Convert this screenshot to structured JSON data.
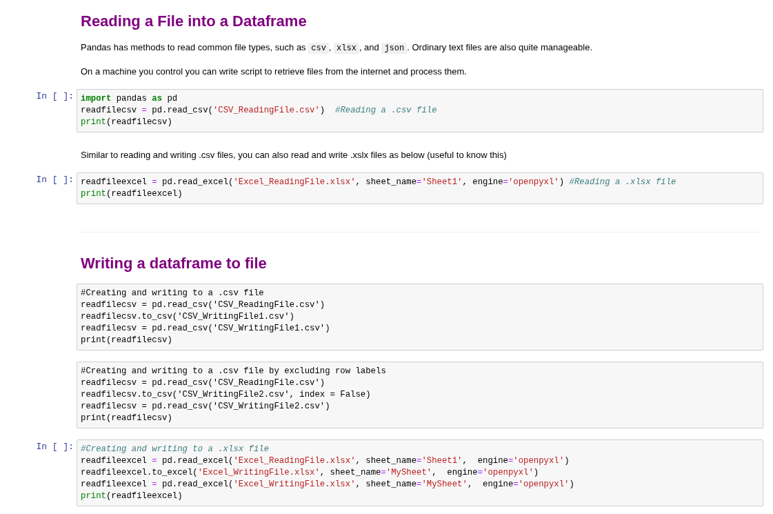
{
  "cells": [
    {
      "kind": "heading",
      "text": "Reading a File into a Dataframe"
    },
    {
      "kind": "paragraph",
      "parts": [
        {
          "kind": "text",
          "text": "Pandas has methods to read common file types, such as "
        },
        {
          "kind": "code",
          "text": "csv"
        },
        {
          "kind": "text",
          "text": ", "
        },
        {
          "kind": "code",
          "text": "xlsx"
        },
        {
          "kind": "text",
          "text": ", and "
        },
        {
          "kind": "code",
          "text": "json"
        },
        {
          "kind": "text",
          "text": ". Ordinary text files are also quite manageable."
        }
      ]
    },
    {
      "kind": "paragraph",
      "parts": [
        {
          "kind": "text",
          "text": "On a machine you control you can write script to retrieve files from the internet and process them."
        }
      ]
    },
    {
      "kind": "code",
      "prompt": "In [ ]:",
      "lines": [
        [
          {
            "kind": "keyword",
            "text": "import"
          },
          {
            "kind": "plain",
            "text": " pandas "
          },
          {
            "kind": "keyword",
            "text": "as"
          },
          {
            "kind": "plain",
            "text": " pd"
          }
        ],
        [
          {
            "kind": "plain",
            "text": "readfilecsv "
          },
          {
            "kind": "operator",
            "text": "="
          },
          {
            "kind": "plain",
            "text": " pd.read_csv("
          },
          {
            "kind": "string",
            "text": "'CSV_ReadingFile.csv'"
          },
          {
            "kind": "plain",
            "text": ")  "
          },
          {
            "kind": "comment",
            "text": "#Reading a .csv file"
          }
        ],
        [
          {
            "kind": "builtin",
            "text": "print"
          },
          {
            "kind": "plain",
            "text": "(readfilecsv)"
          }
        ]
      ]
    },
    {
      "kind": "paragraph",
      "parts": [
        {
          "kind": "text",
          "text": "Similar to reading and writing .csv files, you can also read and write .xslx files as below (useful to know this)"
        }
      ]
    },
    {
      "kind": "code",
      "prompt": "In [ ]:",
      "lines": [
        [
          {
            "kind": "plain",
            "text": "readfileexcel "
          },
          {
            "kind": "operator",
            "text": "="
          },
          {
            "kind": "plain",
            "text": " pd.read_excel("
          },
          {
            "kind": "string",
            "text": "'Excel_ReadingFile.xlsx'"
          },
          {
            "kind": "plain",
            "text": ", sheet_name"
          },
          {
            "kind": "operator",
            "text": "="
          },
          {
            "kind": "string",
            "text": "'Sheet1'"
          },
          {
            "kind": "plain",
            "text": ", engine"
          },
          {
            "kind": "operator",
            "text": "="
          },
          {
            "kind": "string",
            "text": "'openpyxl'"
          },
          {
            "kind": "plain",
            "text": ") "
          },
          {
            "kind": "comment",
            "text": "#Reading a .xlsx file"
          }
        ],
        [
          {
            "kind": "builtin",
            "text": "print"
          },
          {
            "kind": "plain",
            "text": "(readfileexcel)"
          }
        ]
      ]
    },
    {
      "kind": "rule"
    },
    {
      "kind": "heading",
      "text": "Writing a dataframe to file"
    },
    {
      "kind": "code",
      "lines": [
        [
          {
            "kind": "plain",
            "text": "#Creating and writing to a .csv file"
          }
        ],
        [
          {
            "kind": "plain",
            "text": "readfilecsv = pd.read_csv('CSV_ReadingFile.csv')"
          }
        ],
        [
          {
            "kind": "plain",
            "text": "readfilecsv.to_csv('CSV_WritingFile1.csv')"
          }
        ],
        [
          {
            "kind": "plain",
            "text": "readfilecsv = pd.read_csv('CSV_WritingFile1.csv')"
          }
        ],
        [
          {
            "kind": "plain",
            "text": "print(readfilecsv)"
          }
        ]
      ]
    },
    {
      "kind": "code",
      "lines": [
        [
          {
            "kind": "plain",
            "text": "#Creating and writing to a .csv file by excluding row labels"
          }
        ],
        [
          {
            "kind": "plain",
            "text": "readfilecsv = pd.read_csv('CSV_ReadingFile.csv')"
          }
        ],
        [
          {
            "kind": "plain",
            "text": "readfilecsv.to_csv('CSV_WritingFile2.csv', index = False)"
          }
        ],
        [
          {
            "kind": "plain",
            "text": "readfilecsv = pd.read_csv('CSV_WritingFile2.csv')"
          }
        ],
        [
          {
            "kind": "plain",
            "text": "print(readfilecsv)"
          }
        ]
      ]
    },
    {
      "kind": "code",
      "prompt": "In [ ]:",
      "lines": [
        [
          {
            "kind": "comment",
            "text": "#Creating and writing to a .xlsx file"
          }
        ],
        [
          {
            "kind": "plain",
            "text": "readfileexcel "
          },
          {
            "kind": "operator",
            "text": "="
          },
          {
            "kind": "plain",
            "text": " pd.read_excel("
          },
          {
            "kind": "string",
            "text": "'Excel_ReadingFile.xlsx'"
          },
          {
            "kind": "plain",
            "text": ", sheet_name"
          },
          {
            "kind": "operator",
            "text": "="
          },
          {
            "kind": "string",
            "text": "'Sheet1'"
          },
          {
            "kind": "plain",
            "text": ",  engine"
          },
          {
            "kind": "operator",
            "text": "="
          },
          {
            "kind": "string",
            "text": "'openpyxl'"
          },
          {
            "kind": "plain",
            "text": ")"
          }
        ],
        [
          {
            "kind": "plain",
            "text": "readfileexcel.to_excel("
          },
          {
            "kind": "string",
            "text": "'Excel_WritingFile.xlsx'"
          },
          {
            "kind": "plain",
            "text": ", sheet_name"
          },
          {
            "kind": "operator",
            "text": "="
          },
          {
            "kind": "string",
            "text": "'MySheet'"
          },
          {
            "kind": "plain",
            "text": ",  engine"
          },
          {
            "kind": "operator",
            "text": "="
          },
          {
            "kind": "string",
            "text": "'openpyxl'"
          },
          {
            "kind": "plain",
            "text": ")"
          }
        ],
        [
          {
            "kind": "plain",
            "text": "readfileexcel "
          },
          {
            "kind": "operator",
            "text": "="
          },
          {
            "kind": "plain",
            "text": " pd.read_excel("
          },
          {
            "kind": "string",
            "text": "'Excel_WritingFile.xlsx'"
          },
          {
            "kind": "plain",
            "text": ", sheet_name"
          },
          {
            "kind": "operator",
            "text": "="
          },
          {
            "kind": "string",
            "text": "'MySheet'"
          },
          {
            "kind": "plain",
            "text": ",  engine"
          },
          {
            "kind": "operator",
            "text": "="
          },
          {
            "kind": "string",
            "text": "'openpyxl'"
          },
          {
            "kind": "plain",
            "text": ")"
          }
        ],
        [
          {
            "kind": "builtin",
            "text": "print"
          },
          {
            "kind": "plain",
            "text": "(readfileexcel)"
          }
        ]
      ]
    }
  ]
}
